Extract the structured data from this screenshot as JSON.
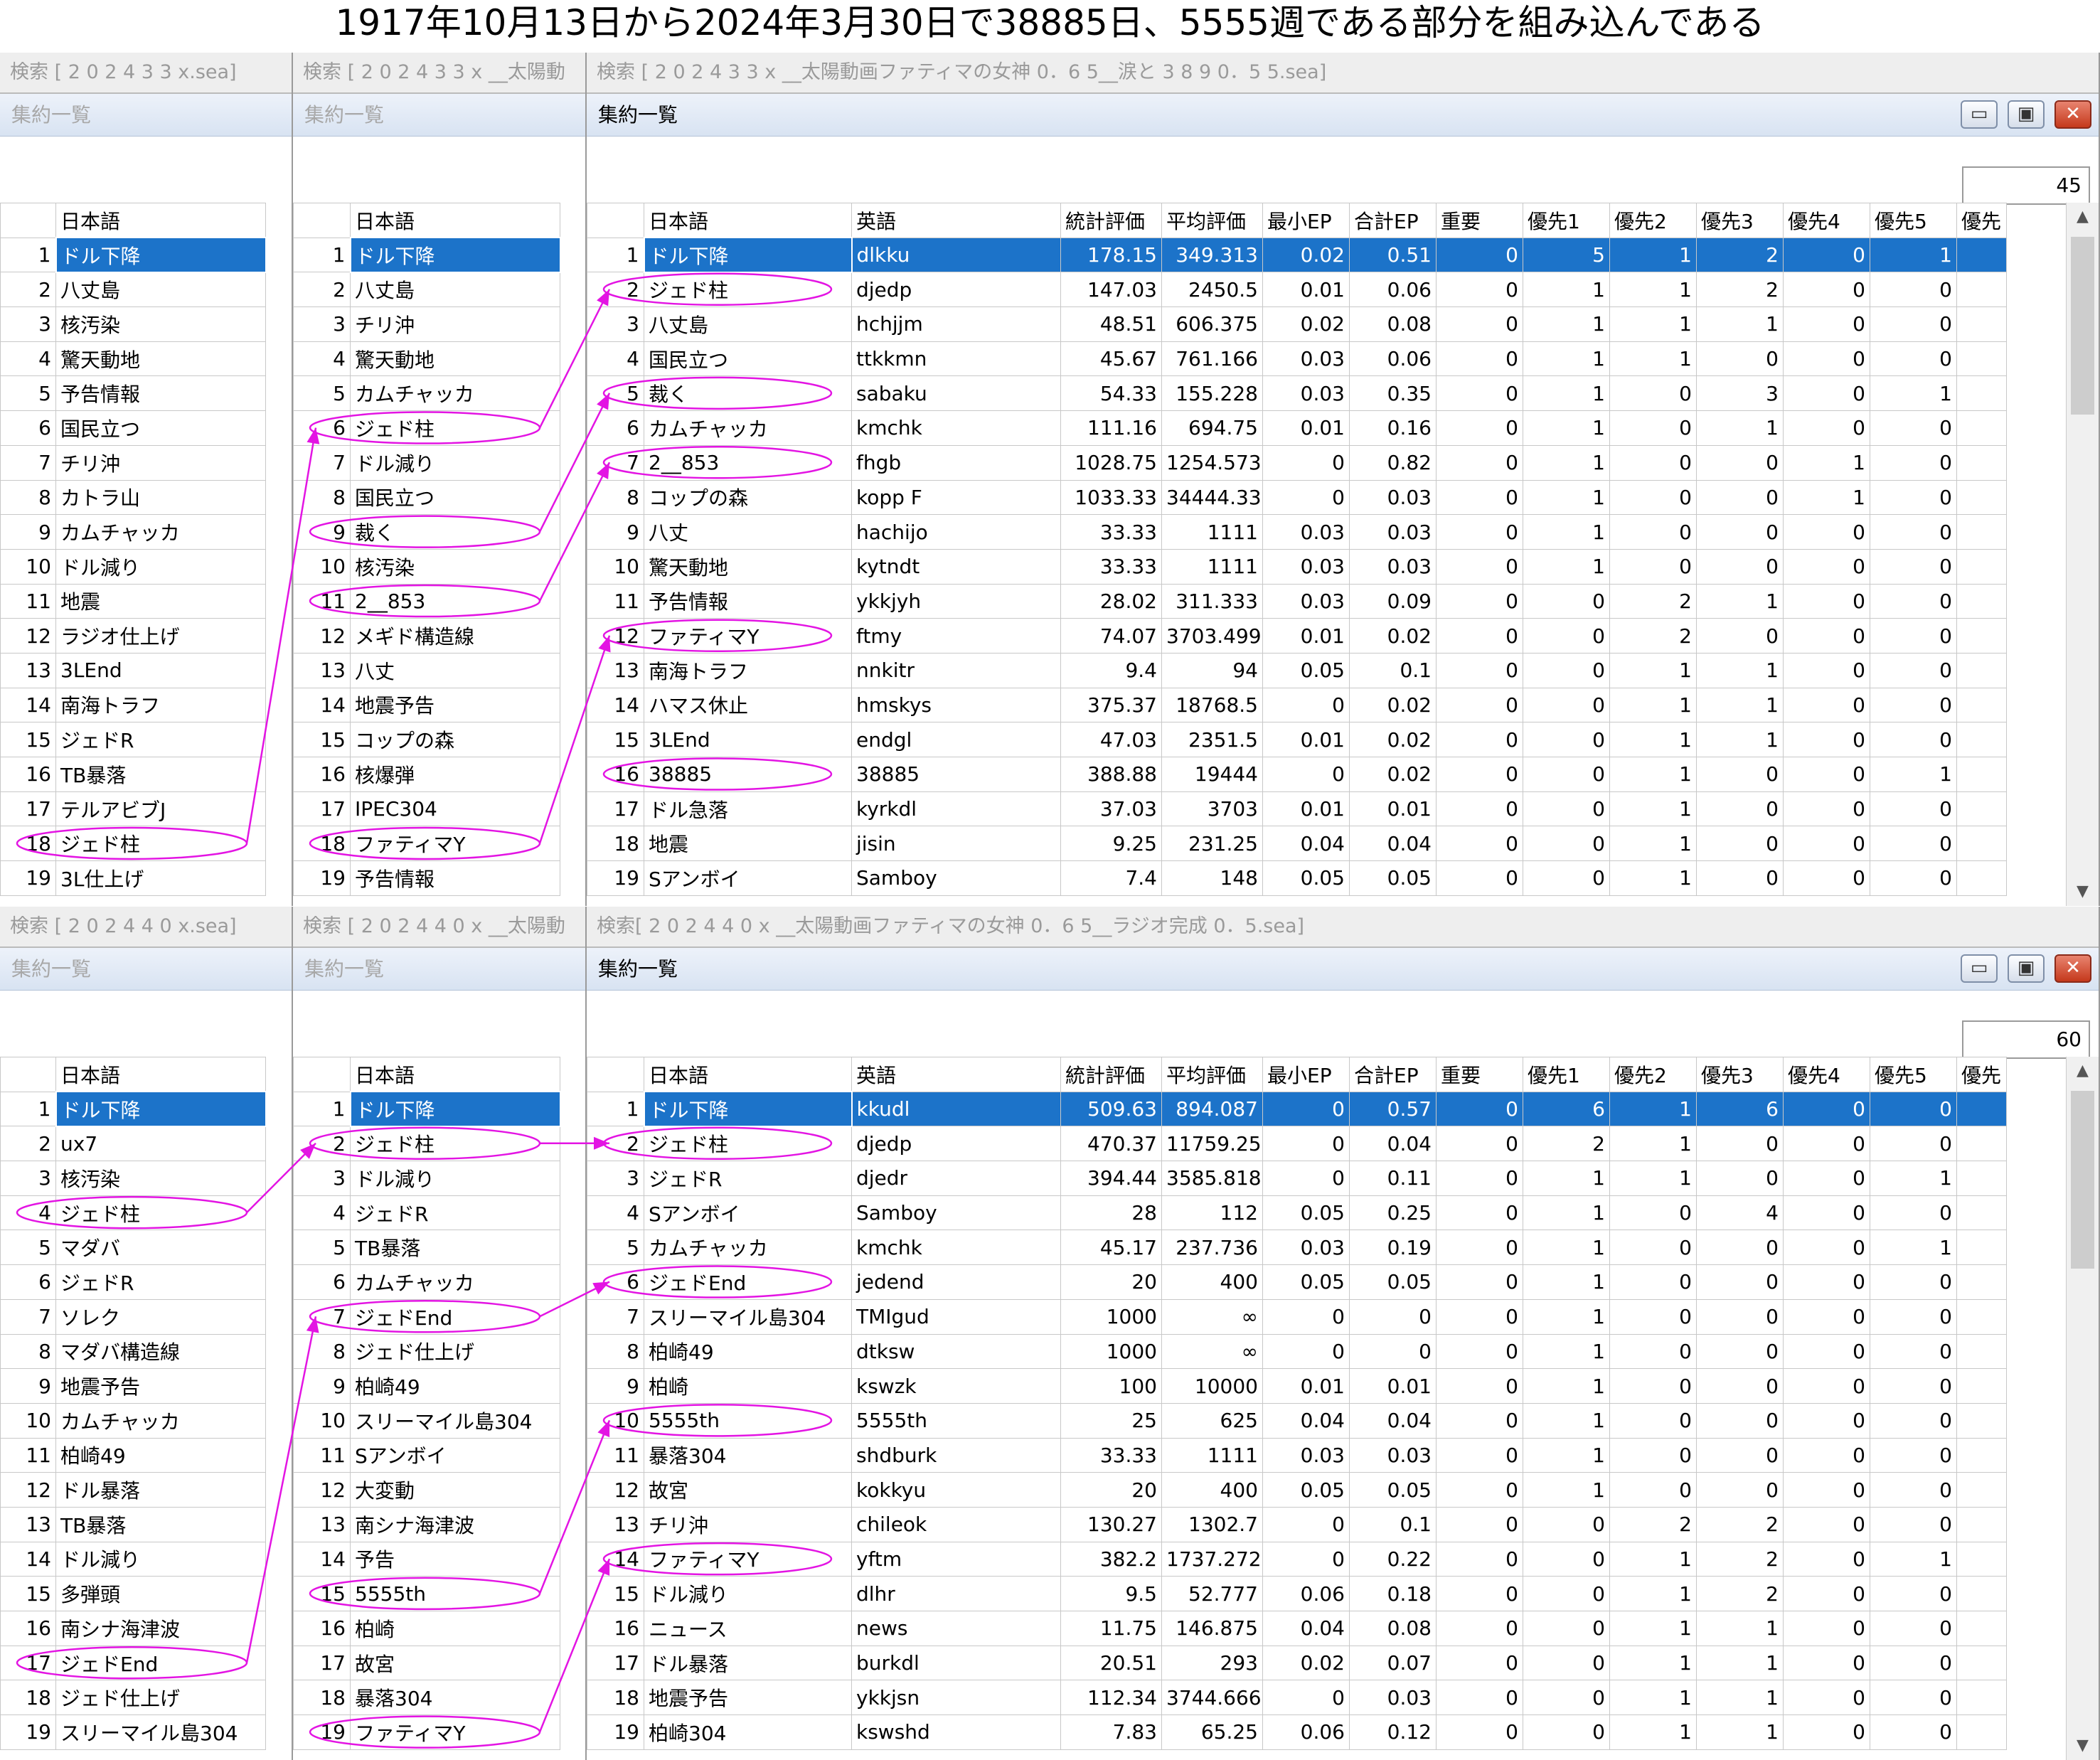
{
  "caption": "1917年10月13日から2024年3月30日で38885日、5555週である部分を組み込んである",
  "accent": "#e314e3",
  "icons": {
    "minimize": "minimize-icon",
    "maximize": "maximize-icon",
    "close": "close-icon"
  },
  "panes": [
    {
      "count": "45",
      "win1": {
        "title": "検索 [ 2 0 2 4 3 3 x.sea]",
        "subtitle": "集約一覧",
        "header": [
          "日本語"
        ],
        "rows": [
          "ドル下降",
          "八丈島",
          "核汚染",
          "驚天動地",
          "予告情報",
          "国民立つ",
          "チリ沖",
          "カトラ山",
          "カムチャッカ",
          "ドル減り",
          "地震",
          "ラジオ仕上げ",
          "3LEnd",
          "南海トラフ",
          "ジェドR",
          "TB暴落",
          "テルアビブJ",
          "ジェド柱",
          "3L仕上げ"
        ]
      },
      "win2": {
        "title": "検索 [ 2 0 2 4 3 3 x __太陽動",
        "subtitle": "集約一覧",
        "header": [
          "日本語"
        ],
        "rows": [
          "ドル下降",
          "八丈島",
          "チリ沖",
          "驚天動地",
          "カムチャッカ",
          "ジェド柱",
          "ドル減り",
          "国民立つ",
          "裁く",
          "核汚染",
          "2__853",
          "メギド構造線",
          "八丈",
          "地震予告",
          "コップの森",
          "核爆弾",
          "IPEC304",
          "ファティマY",
          "予告情報"
        ]
      },
      "win3": {
        "title": "検索 [ 2 0 2 4 3 3 x __太陽動画ファティマの女神 0．6 5__涙と 3 8 9 0．5 5.sea]",
        "subtitle": "集約一覧",
        "header": [
          "日本語",
          "英語",
          "統計評価",
          "平均評価",
          "最小EP",
          "合計EP",
          "重要",
          "優先1",
          "優先2",
          "優先3",
          "優先4",
          "優先5",
          "優先"
        ],
        "rows": [
          [
            "ドル下降",
            "dlkku",
            "178.15",
            "349.313",
            "0.02",
            "0.51",
            "0",
            "5",
            "1",
            "2",
            "0",
            "1"
          ],
          [
            "ジェド柱",
            "djedp",
            "147.03",
            "2450.5",
            "0.01",
            "0.06",
            "0",
            "1",
            "1",
            "2",
            "0",
            "0"
          ],
          [
            "八丈島",
            "hchjjm",
            "48.51",
            "606.375",
            "0.02",
            "0.08",
            "0",
            "1",
            "1",
            "1",
            "0",
            "0"
          ],
          [
            "国民立つ",
            "ttkkmn",
            "45.67",
            "761.166",
            "0.03",
            "0.06",
            "0",
            "1",
            "1",
            "0",
            "0",
            "0"
          ],
          [
            "裁く",
            "sabaku",
            "54.33",
            "155.228",
            "0.03",
            "0.35",
            "0",
            "1",
            "0",
            "3",
            "0",
            "1"
          ],
          [
            "カムチャッカ",
            "kmchk",
            "111.16",
            "694.75",
            "0.01",
            "0.16",
            "0",
            "1",
            "0",
            "1",
            "0",
            "0"
          ],
          [
            "2__853",
            "fhgb",
            "1028.75",
            "1254.573",
            "0",
            "0.82",
            "0",
            "1",
            "0",
            "0",
            "1",
            "0"
          ],
          [
            "コップの森",
            "kopp F",
            "1033.33",
            "34444.333",
            "0",
            "0.03",
            "0",
            "1",
            "0",
            "0",
            "1",
            "0"
          ],
          [
            "八丈",
            "hachijo",
            "33.33",
            "1111",
            "0.03",
            "0.03",
            "0",
            "1",
            "0",
            "0",
            "0",
            "0"
          ],
          [
            "驚天動地",
            "kytndt",
            "33.33",
            "1111",
            "0.03",
            "0.03",
            "0",
            "1",
            "0",
            "0",
            "0",
            "0"
          ],
          [
            "予告情報",
            "ykkjyh",
            "28.02",
            "311.333",
            "0.03",
            "0.09",
            "0",
            "0",
            "2",
            "1",
            "0",
            "0"
          ],
          [
            "ファティマY",
            "ftmy",
            "74.07",
            "3703.499",
            "0.01",
            "0.02",
            "0",
            "0",
            "2",
            "0",
            "0",
            "0"
          ],
          [
            "南海トラフ",
            "nnkitr",
            "9.4",
            "94",
            "0.05",
            "0.1",
            "0",
            "0",
            "1",
            "1",
            "0",
            "0"
          ],
          [
            "ハマス休止",
            "hmskys",
            "375.37",
            "18768.5",
            "0",
            "0.02",
            "0",
            "0",
            "1",
            "1",
            "0",
            "0"
          ],
          [
            "3LEnd",
            "endgl",
            "47.03",
            "2351.5",
            "0.01",
            "0.02",
            "0",
            "0",
            "1",
            "1",
            "0",
            "0"
          ],
          [
            "38885",
            "38885",
            "388.88",
            "19444",
            "0",
            "0.02",
            "0",
            "0",
            "1",
            "0",
            "0",
            "1"
          ],
          [
            "ドル急落",
            "kyrkdl",
            "37.03",
            "3703",
            "0.01",
            "0.01",
            "0",
            "0",
            "1",
            "0",
            "0",
            "0"
          ],
          [
            "地震",
            "jisin",
            "9.25",
            "231.25",
            "0.04",
            "0.04",
            "0",
            "0",
            "1",
            "0",
            "0",
            "0"
          ],
          [
            "Sアンボイ",
            "Samboy",
            "7.4",
            "148",
            "0.05",
            "0.05",
            "0",
            "0",
            "1",
            "0",
            "0",
            "0"
          ]
        ]
      }
    },
    {
      "count": "60",
      "win1": {
        "title": "検索 [ 2 0 2 4 4 0 x.sea]",
        "subtitle": "集約一覧",
        "header": [
          "日本語"
        ],
        "rows": [
          "ドル下降",
          "ux7",
          "核汚染",
          "ジェド柱",
          "マダバ",
          "ジェドR",
          "ソレク",
          "マダバ構造線",
          "地震予告",
          "カムチャッカ",
          "柏崎49",
          "ドル暴落",
          "TB暴落",
          "ドル減り",
          "多弾頭",
          "南シナ海津波",
          "ジェドEnd",
          "ジェド仕上げ",
          "スリーマイル島304"
        ]
      },
      "win2": {
        "title": "検索 [ 2 0 2 4 4 0 x __太陽動",
        "subtitle": "集約一覧",
        "header": [
          "日本語"
        ],
        "rows": [
          "ドル下降",
          "ジェド柱",
          "ドル減り",
          "ジェドR",
          "TB暴落",
          "カムチャッカ",
          "ジェドEnd",
          "ジェド仕上げ",
          "柏崎49",
          "スリーマイル島304",
          "Sアンボイ",
          "大変動",
          "南シナ海津波",
          "予告",
          "5555th",
          "柏崎",
          "故宮",
          "暴落304",
          "ファティマY"
        ]
      },
      "win3": {
        "title": "検索[ 2 0 2 4 4 0 x __太陽動画ファティマの女神 0．6 5__ラジオ完成 0．5.sea]",
        "subtitle": "集約一覧",
        "header": [
          "日本語",
          "英語",
          "統計評価",
          "平均評価",
          "最小EP",
          "合計EP",
          "重要",
          "優先1",
          "優先2",
          "優先3",
          "優先4",
          "優先5",
          "優先"
        ],
        "rows": [
          [
            "ドル下降",
            "kkudl",
            "509.63",
            "894.087",
            "0",
            "0.57",
            "0",
            "6",
            "1",
            "6",
            "0",
            "0"
          ],
          [
            "ジェド柱",
            "djedp",
            "470.37",
            "11759.25",
            "0",
            "0.04",
            "0",
            "2",
            "1",
            "0",
            "0",
            "0"
          ],
          [
            "ジェドR",
            "djedr",
            "394.44",
            "3585.818",
            "0",
            "0.11",
            "0",
            "1",
            "1",
            "0",
            "0",
            "1"
          ],
          [
            "Sアンボイ",
            "Samboy",
            "28",
            "112",
            "0.05",
            "0.25",
            "0",
            "1",
            "0",
            "4",
            "0",
            "0"
          ],
          [
            "カムチャッカ",
            "kmchk",
            "45.17",
            "237.736",
            "0.03",
            "0.19",
            "0",
            "1",
            "0",
            "0",
            "0",
            "1"
          ],
          [
            "ジェドEnd",
            "jedend",
            "20",
            "400",
            "0.05",
            "0.05",
            "0",
            "1",
            "0",
            "0",
            "0",
            "0"
          ],
          [
            "スリーマイル島304",
            "TMIgud",
            "1000",
            "∞",
            "0",
            "0",
            "0",
            "1",
            "0",
            "0",
            "0",
            "0"
          ],
          [
            "柏崎49",
            "dtksw",
            "1000",
            "∞",
            "0",
            "0",
            "0",
            "1",
            "0",
            "0",
            "0",
            "0"
          ],
          [
            "柏崎",
            "kswzk",
            "100",
            "10000",
            "0.01",
            "0.01",
            "0",
            "1",
            "0",
            "0",
            "0",
            "0"
          ],
          [
            "5555th",
            "5555th",
            "25",
            "625",
            "0.04",
            "0.04",
            "0",
            "1",
            "0",
            "0",
            "0",
            "0"
          ],
          [
            "暴落304",
            "shdburk",
            "33.33",
            "1111",
            "0.03",
            "0.03",
            "0",
            "1",
            "0",
            "0",
            "0",
            "0"
          ],
          [
            "故宮",
            "kokkyu",
            "20",
            "400",
            "0.05",
            "0.05",
            "0",
            "1",
            "0",
            "0",
            "0",
            "0"
          ],
          [
            "チリ沖",
            "chileok",
            "130.27",
            "1302.7",
            "0",
            "0.1",
            "0",
            "0",
            "2",
            "2",
            "0",
            "0"
          ],
          [
            "ファティマY",
            "yftm",
            "382.2",
            "1737.272",
            "0",
            "0.22",
            "0",
            "0",
            "1",
            "2",
            "0",
            "1"
          ],
          [
            "ドル減り",
            "dlhr",
            "9.5",
            "52.777",
            "0.06",
            "0.18",
            "0",
            "0",
            "1",
            "2",
            "0",
            "0"
          ],
          [
            "ニュース",
            "news",
            "11.75",
            "146.875",
            "0.04",
            "0.08",
            "0",
            "0",
            "1",
            "1",
            "0",
            "0"
          ],
          [
            "ドル暴落",
            "burkdl",
            "20.51",
            "293",
            "0.02",
            "0.07",
            "0",
            "0",
            "1",
            "1",
            "0",
            "0"
          ],
          [
            "地震予告",
            "ykkjsn",
            "112.34",
            "3744.666",
            "0",
            "0.03",
            "0",
            "0",
            "1",
            "1",
            "0",
            "0"
          ],
          [
            "柏崎304",
            "kswshd",
            "7.83",
            "65.25",
            "0.06",
            "0.12",
            "0",
            "0",
            "1",
            "1",
            "0",
            "0"
          ]
        ]
      }
    }
  ]
}
